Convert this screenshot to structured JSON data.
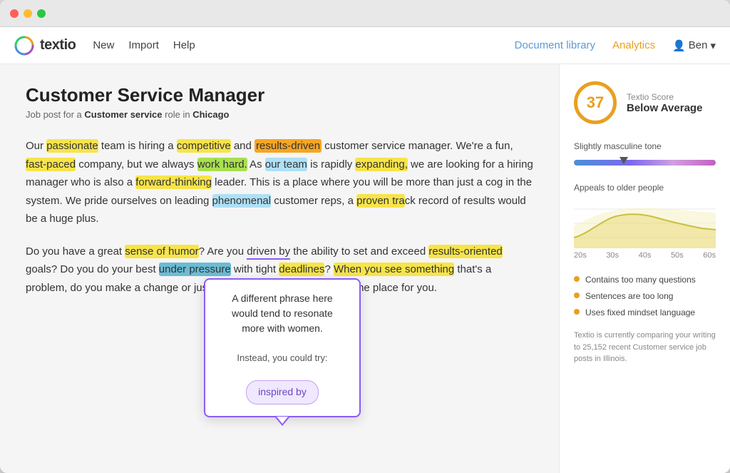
{
  "window": {
    "title": "Textio"
  },
  "navbar": {
    "logo": "textio",
    "links": [
      {
        "label": "New",
        "id": "new"
      },
      {
        "label": "Import",
        "id": "import"
      },
      {
        "label": "Help",
        "id": "help"
      }
    ],
    "right_links": [
      {
        "label": "Document library",
        "id": "doc-library"
      },
      {
        "label": "Analytics",
        "id": "analytics"
      }
    ],
    "user": "Ben"
  },
  "document": {
    "title": "Customer Service Manager",
    "subtitle_prefix": "Job post for a",
    "subtitle_role": "Customer service",
    "subtitle_mid": "role in",
    "subtitle_location": "Chicago"
  },
  "tooltip": {
    "main_text": "A different phrase here would tend to resonate more with women.",
    "instead_label": "Instead, you could try:",
    "suggestion": "inspired by"
  },
  "sidebar": {
    "score_value": "37",
    "score_label": "Textio Score",
    "score_desc": "Below Average",
    "tone_label": "Slightly masculine tone",
    "age_label": "Appeals to older people",
    "age_labels": [
      "20s",
      "30s",
      "40s",
      "50s",
      "60s"
    ],
    "bullets": [
      "Contains too many questions",
      "Sentences are too long",
      "Uses fixed mindset language"
    ],
    "comparing_text": "Textio is currently comparing your writing to 25,152 recent Customer service job posts in Illinois."
  }
}
